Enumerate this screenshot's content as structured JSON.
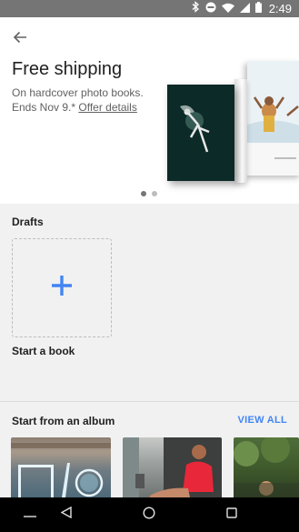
{
  "status_bar": {
    "time": "2:49"
  },
  "promo": {
    "title": "Free shipping",
    "line1": "On hardcover photo books.",
    "line2_prefix": "Ends Nov 9.* ",
    "offer_link": "Offer details",
    "carousel_pages": 2,
    "carousel_active": 1
  },
  "drafts": {
    "title": "Drafts",
    "new_book_label": "Start a book"
  },
  "albums_section": {
    "title": "Start from an album",
    "view_all": "VIEW ALL",
    "albums": [
      "album-1",
      "album-2",
      "album-3"
    ]
  },
  "colors": {
    "accent": "#4285f4",
    "status_bar": "#757575",
    "background": "#f1f1f1",
    "card": "#ffffff",
    "nav_bar": "#000000"
  },
  "icons": {
    "back": "arrow-back-icon",
    "add": "plus-icon",
    "bluetooth": "bluetooth-icon",
    "dnd": "do-not-disturb-icon",
    "wifi": "wifi-icon",
    "signal": "cell-signal-icon",
    "battery": "battery-icon"
  }
}
